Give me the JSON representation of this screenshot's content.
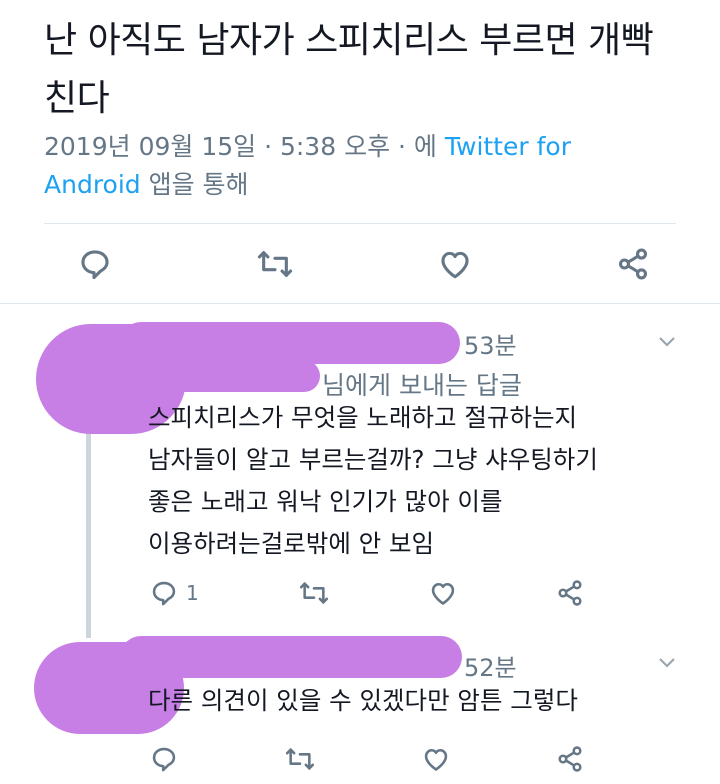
{
  "tweet": {
    "text": "난 아직도 남자가 스피치리스 부르면 개빡친다",
    "timestamp": "2019년 09월 15일 · 5:38 오후 · 에 ",
    "via": "Twitter for Android",
    "via_suffix": " 앱을 통해"
  },
  "actions_icons": [
    "reply-icon",
    "retweet-icon",
    "like-icon",
    "share-icon"
  ],
  "replies": [
    {
      "time": "53분",
      "reply_to": "님에게 보내는 답글",
      "text_lines": [
        "스피치리스가 무엇을 노래하고 절규하는지",
        "남자들이 알고 부르는걸까? 그냥 샤우팅하기",
        "좋은 노래고 워낙 인기가 많아 이를",
        "이용하려는걸로밖에 안 보임"
      ],
      "reply_count": "1"
    },
    {
      "time": "52분",
      "text_lines": [
        "다른 의견이 있을 수 있겠다만 암튼 그렇다"
      ]
    }
  ],
  "colors": {
    "accent": "#1da1f2",
    "redaction": "#c77fe5",
    "muted": "#657786"
  }
}
